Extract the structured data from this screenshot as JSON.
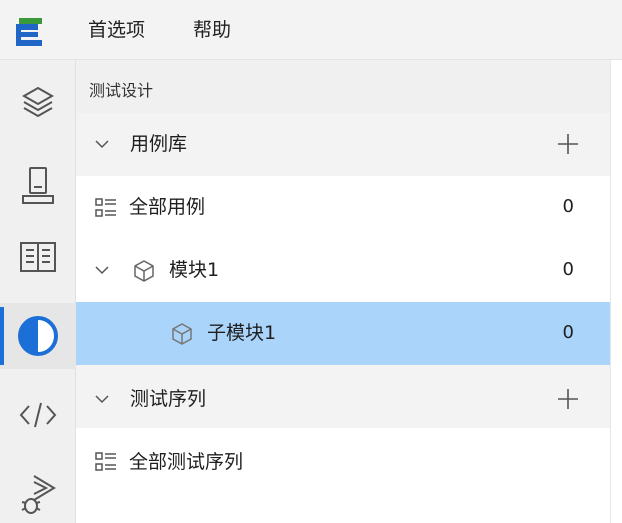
{
  "menubar": {
    "logo_icon": "app-logo",
    "items": [
      "首选项",
      "帮助"
    ]
  },
  "activitybar": {
    "icons": [
      "layers-icon",
      "device-icon",
      "book-icon",
      "contrast-icon",
      "code-icon",
      "debug-run-icon"
    ],
    "active_index": 3
  },
  "panel": {
    "title": "测试设计",
    "tree": {
      "case_library": {
        "label": "用例库",
        "expanded": true
      },
      "all_cases": {
        "label": "全部用例",
        "count": "0"
      },
      "module1": {
        "label": "模块1",
        "count": "0",
        "expanded": true
      },
      "submodule1": {
        "label": "子模块1",
        "count": "0",
        "selected": true
      },
      "test_sequence": {
        "label": "测试序列",
        "expanded": true
      },
      "all_sequences": {
        "label": "全部测试序列"
      }
    }
  },
  "colors": {
    "accent": "#1d6fd8",
    "selected_row": "#abd4fb",
    "section_bg": "#f3f3f3"
  }
}
